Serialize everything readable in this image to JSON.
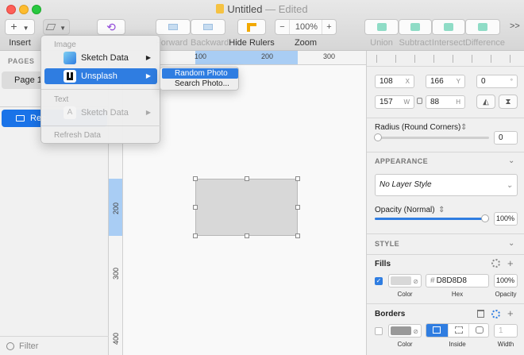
{
  "window": {
    "title": "Untitled",
    "status": "— Edited"
  },
  "toolbar": {
    "insert_label": "Insert",
    "forward_label": "Forward",
    "backward_label": "Backward",
    "hide_rulers_label": "Hide Rulers",
    "zoom_label": "Zoom",
    "zoom_value": "100%",
    "zoom_minus": "−",
    "zoom_plus": "+",
    "union_label": "Union",
    "subtract_label": "Subtract",
    "intersect_label": "Intersect",
    "difference_label": "Difference",
    "overflow": ">>"
  },
  "sidebar": {
    "pages_header": "PAGES",
    "page_item": "Page 1",
    "layer_item": "Rec",
    "filter_placeholder": "Filter"
  },
  "data_menu": {
    "image_header": "Image",
    "sketch_data": "Sketch Data",
    "unsplash": "Unsplash",
    "text_header": "Text",
    "text_sketch_data": "Sketch Data",
    "refresh_data": "Refresh Data",
    "arrow": "▶"
  },
  "unsplash_submenu": {
    "random_photo": "Random Photo",
    "search_photo": "Search Photo..."
  },
  "rulers": {
    "top": [
      "100",
      "200",
      "300"
    ],
    "left": [
      "200",
      "300",
      "400"
    ]
  },
  "inspector": {
    "x": "108",
    "x_suffix": "X",
    "y": "166",
    "y_suffix": "Y",
    "rotation": "0",
    "rotation_suffix": "°",
    "w": "157",
    "w_suffix": "W",
    "h": "88",
    "h_suffix": "H",
    "radius_label": "Radius (Round Corners)",
    "radius_value": "0",
    "appearance_header": "APPEARANCE",
    "layer_style": "No Layer Style",
    "opacity_label": "Opacity (Normal)",
    "opacity_value": "100%",
    "opacity_level": 1.0,
    "style_header": "STYLE",
    "fills_header": "Fills",
    "fill_hex": "D8D8D8",
    "fill_hex_prefix": "#",
    "fill_opacity": "100%",
    "fill_color": "#d8d8d8",
    "fill_enabled": true,
    "color_caption": "Color",
    "hex_caption": "Hex",
    "opacity_caption": "Opacity",
    "borders_header": "Borders",
    "border_color": "#999999",
    "border_color_caption": "Color",
    "inside_caption": "Inside",
    "width_caption": "Width",
    "border_width": "1"
  },
  "colors": {
    "accent": "#2f7de1",
    "selection": "#1a73e8"
  }
}
